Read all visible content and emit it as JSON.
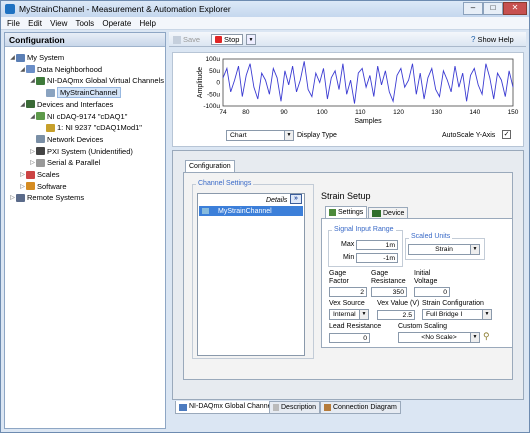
{
  "window": {
    "title": "MyStrainChannel - Measurement & Automation Explorer"
  },
  "menu": [
    "File",
    "Edit",
    "View",
    "Tools",
    "Operate",
    "Help"
  ],
  "left": {
    "header": "Configuration"
  },
  "tree": [
    {
      "label": "My System",
      "level": 0,
      "icon": "computer-icon",
      "toggle": "◢"
    },
    {
      "label": "Data Neighborhood",
      "level": 1,
      "icon": "folder-icon",
      "toggle": "◢"
    },
    {
      "label": "NI-DAQmx Global Virtual Channels",
      "level": 2,
      "icon": "channels-icon",
      "toggle": "◢"
    },
    {
      "label": "MyStrainChannel",
      "level": 3,
      "icon": "channel-icon",
      "toggle": "",
      "selected": true
    },
    {
      "label": "Devices and Interfaces",
      "level": 1,
      "icon": "devices-icon",
      "toggle": "◢"
    },
    {
      "label": "NI cDAQ-9174 \"cDAQ1\"",
      "level": 2,
      "icon": "chassis-icon",
      "toggle": "◢"
    },
    {
      "label": "1: NI 9237 \"cDAQ1Mod1\"",
      "level": 3,
      "icon": "module-icon",
      "toggle": ""
    },
    {
      "label": "Network Devices",
      "level": 2,
      "icon": "network-icon",
      "toggle": ""
    },
    {
      "label": "PXI System (Unidentified)",
      "level": 2,
      "icon": "pxi-icon",
      "toggle": "▷"
    },
    {
      "label": "Serial & Parallel",
      "level": 2,
      "icon": "serial-icon",
      "toggle": "▷"
    },
    {
      "label": "Scales",
      "level": 1,
      "icon": "scales-icon",
      "toggle": "▷"
    },
    {
      "label": "Software",
      "level": 1,
      "icon": "software-icon",
      "toggle": "▷"
    },
    {
      "label": "Remote Systems",
      "level": 0,
      "icon": "remote-icon",
      "toggle": "▷"
    }
  ],
  "toolbar": {
    "save": "Save",
    "stop": "Stop",
    "help": "Show Help"
  },
  "chart_data": {
    "type": "line",
    "xlabel": "Samples",
    "ylabel": "Amplitude",
    "xlim": [
      74,
      150
    ],
    "ylim": [
      -100,
      100
    ],
    "xticks": [
      "74",
      "80",
      "90",
      "100",
      "110",
      "120",
      "130",
      "140",
      "150"
    ],
    "yticks": [
      "100u",
      "50u",
      "0",
      "-50u",
      "-100u"
    ],
    "values": [
      20,
      60,
      -40,
      10,
      70,
      -60,
      30,
      80,
      -20,
      -70,
      40,
      10,
      -50,
      60,
      20,
      -80,
      50,
      -10,
      70,
      -40,
      10,
      90,
      -30,
      -60,
      40,
      0,
      60,
      -70,
      20,
      50,
      -30,
      80,
      -50,
      10,
      -90,
      40,
      60,
      -20,
      30,
      -60,
      70,
      -10,
      50,
      -40,
      -80,
      30,
      60,
      -20,
      10,
      80,
      -50,
      40,
      -70,
      20,
      60,
      -30,
      -60,
      50,
      10,
      -40,
      70,
      -20,
      40,
      -80,
      30,
      60,
      -10,
      -50,
      80,
      20,
      -70,
      40,
      10,
      -60,
      50,
      -20
    ]
  },
  "display": {
    "type": "Chart",
    "type_label": "Display Type",
    "autoscale": "AutoScale Y-Axis"
  },
  "tabs": {
    "configuration": "Configuration"
  },
  "channel_settings": {
    "title": "Channel Settings",
    "details": "Details",
    "channel": "MyStrainChannel"
  },
  "strain": {
    "title": "Strain Setup",
    "tab_settings": "Settings",
    "tab_device": "Device",
    "sir": "Signal Input Range",
    "max_label": "Max",
    "max": "1m",
    "min_label": "Min",
    "min": "-1m",
    "scaled_units": "Scaled Units",
    "units": "Strain",
    "gage_factor_label": "Gage\nFactor",
    "gage_factor": "2",
    "gage_res_label": "Gage\nResistance",
    "gage_res": "350",
    "init_v_label": "Initial\nVoltage",
    "init_v": "0",
    "vex_src_label": "Vex Source",
    "vex_src": "Internal",
    "vex_val_label": "Vex Value (V)",
    "vex_val": "2.5",
    "strain_cfg_label": "Strain Configuration",
    "strain_cfg": "Full Bridge I",
    "lead_res_label": "Lead Resistance",
    "lead_res": "0",
    "custom_scaling_label": "Custom Scaling",
    "custom_scaling": "<No Scale>"
  },
  "bottom_tabs": [
    "NI-DAQmx Global Channel",
    "Description",
    "Connection Diagram"
  ],
  "colors": {
    "accent": "#3a6ac7",
    "plot_line": "#3c3cd2",
    "selection": "#3c7fd9"
  }
}
